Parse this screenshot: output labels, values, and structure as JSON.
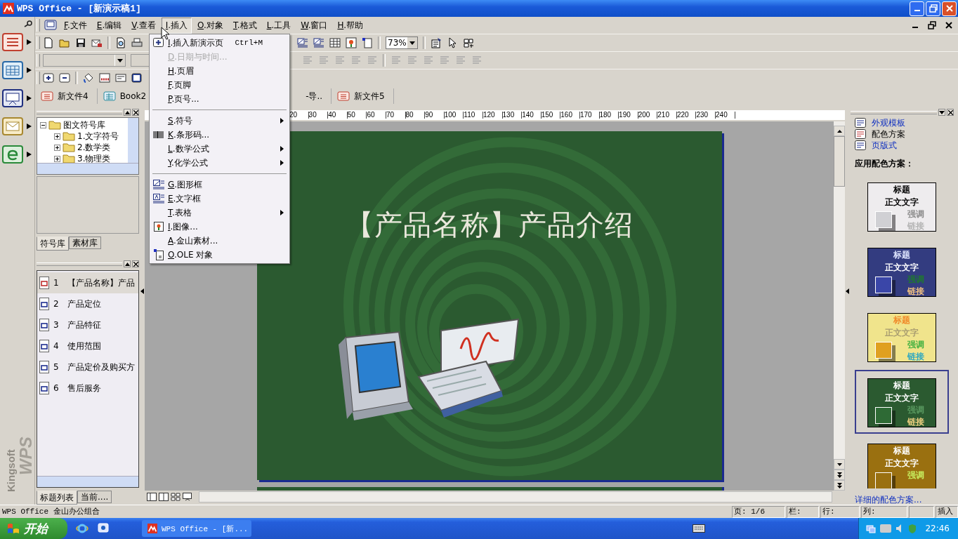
{
  "window": {
    "title": "WPS Office - [新演示稿1]"
  },
  "menubar": [
    {
      "label": "F.文件",
      "selected": false
    },
    {
      "label": "E.编辑",
      "selected": false
    },
    {
      "label": "V.查看",
      "selected": false
    },
    {
      "label": "I.插入",
      "selected": true
    },
    {
      "label": "O.对象",
      "selected": false
    },
    {
      "label": "T.格式",
      "selected": false
    },
    {
      "label": "L.工具",
      "selected": false
    },
    {
      "label": "W.窗口",
      "selected": false
    },
    {
      "label": "H.帮助",
      "selected": false
    }
  ],
  "insert_menu": [
    {
      "kind": "item",
      "label": "I.插入新演示页",
      "shortcut": "Ctrl+M",
      "disabled": false,
      "submenu": false
    },
    {
      "kind": "item",
      "label": "D.日期与时间...",
      "disabled": true,
      "submenu": false
    },
    {
      "kind": "item",
      "label": "H.页眉",
      "disabled": false,
      "submenu": false
    },
    {
      "kind": "item",
      "label": "F.页脚",
      "disabled": false,
      "submenu": false
    },
    {
      "kind": "item",
      "label": "P.页号...",
      "disabled": false,
      "submenu": false
    },
    {
      "kind": "separator"
    },
    {
      "kind": "item",
      "label": "S.符号",
      "disabled": false,
      "submenu": true
    },
    {
      "kind": "item",
      "label": "K.条形码...",
      "disabled": false,
      "submenu": false
    },
    {
      "kind": "item",
      "label": "L.数学公式",
      "disabled": false,
      "submenu": true
    },
    {
      "kind": "item",
      "label": "Y.化学公式",
      "disabled": false,
      "submenu": true
    },
    {
      "kind": "separator"
    },
    {
      "kind": "item",
      "label": "G.图形框",
      "disabled": false,
      "submenu": false
    },
    {
      "kind": "item",
      "label": "E.文字框",
      "disabled": false,
      "submenu": false
    },
    {
      "kind": "item",
      "label": "T.表格",
      "disabled": false,
      "submenu": true
    },
    {
      "kind": "item",
      "label": "I.图像...",
      "disabled": false,
      "submenu": false
    },
    {
      "kind": "item",
      "label": "A.金山素材...",
      "disabled": false,
      "submenu": false
    },
    {
      "kind": "item",
      "label": "O.OLE 对象",
      "disabled": false,
      "submenu": false
    }
  ],
  "toolbar": {
    "zoom": "73%"
  },
  "document_tabs": [
    {
      "label": "新文件4",
      "kind": "presentation"
    },
    {
      "label": "Book2",
      "kind": "spreadsheet"
    },
    {
      "label": "-导..",
      "kind": "other"
    },
    {
      "label": "新文件5",
      "kind": "presentation"
    }
  ],
  "symbol_library": {
    "tree": {
      "label": "图文符号库",
      "expanded": true,
      "children": [
        {
          "label": "1.文字符号",
          "expanded": false
        },
        {
          "label": "2.数学类",
          "expanded": false
        },
        {
          "label": "3.物理类",
          "expanded": false
        }
      ]
    },
    "tabs": [
      {
        "label": "符号库",
        "selected": true
      },
      {
        "label": "素材库",
        "selected": false
      }
    ]
  },
  "slide_outline": {
    "items": [
      {
        "number": "1",
        "title": "【产品名称】产品",
        "selected": true
      },
      {
        "number": "2",
        "title": "产品定位",
        "selected": false
      },
      {
        "number": "3",
        "title": "产品特征",
        "selected": false
      },
      {
        "number": "4",
        "title": "使用范围",
        "selected": false
      },
      {
        "number": "5",
        "title": "产品定价及购买方",
        "selected": false
      },
      {
        "number": "6",
        "title": "售后服务",
        "selected": false
      }
    ],
    "tabs": [
      {
        "label": "标题列表",
        "selected": true
      },
      {
        "label": "当前....",
        "selected": false
      }
    ]
  },
  "ruler": [
    "20",
    "30",
    "40",
    "50",
    "60",
    "70",
    "80",
    "90",
    "100",
    "110",
    "120",
    "130",
    "140",
    "150",
    "160",
    "170",
    "180",
    "190",
    "200",
    "210",
    "220",
    "230",
    "240"
  ],
  "slide": {
    "title": "【产品名称】产品介绍"
  },
  "task_pane": {
    "links": [
      {
        "label": "外观模板",
        "selected": false
      },
      {
        "label": "配色方案",
        "selected": true
      },
      {
        "label": "页版式",
        "selected": false
      }
    ],
    "heading": "应用配色方案：",
    "schemes": [
      {
        "selected": false,
        "color": "#eeecee",
        "title": {
          "text": "标题",
          "color": "#000000"
        },
        "body": {
          "text": "正文文字",
          "color": "#000000"
        },
        "accent": {
          "text": "强调",
          "color": "#8a8a8a"
        },
        "link": {
          "text": "链接",
          "color": "#b4b4b4"
        },
        "box": {
          "color": "#d0d0d4"
        }
      },
      {
        "selected": false,
        "color": "#333c80",
        "title": {
          "text": "标题",
          "color": "#dfe6ff"
        },
        "body": {
          "text": "正文文字",
          "color": "#ffffff"
        },
        "accent": {
          "text": "强调",
          "color": "#1f7a2e"
        },
        "link": {
          "text": "链接",
          "color": "#f0c080"
        },
        "box": {
          "color": "#3a46a8"
        }
      },
      {
        "selected": false,
        "color": "#f0e48c",
        "title": {
          "text": "标题",
          "color": "#f08a2a"
        },
        "body": {
          "text": "正文文字",
          "color": "#a89c70"
        },
        "accent": {
          "text": "强调",
          "color": "#40b040"
        },
        "link": {
          "text": "链接",
          "color": "#30a8c0"
        },
        "box": {
          "color": "#e0a020"
        }
      },
      {
        "selected": true,
        "color": "#2b5a30",
        "title": {
          "text": "标题",
          "color": "#ffffff"
        },
        "body": {
          "text": "正文文字",
          "color": "#ffffff"
        },
        "accent": {
          "text": "强调",
          "color": "#5a9a60"
        },
        "link": {
          "text": "链接",
          "color": "#f0d080"
        },
        "box": {
          "color": "#2e6a35"
        }
      },
      {
        "selected": false,
        "color": "#9a7010",
        "title": {
          "text": "标题",
          "color": "#ffffff"
        },
        "body": {
          "text": "正文文字",
          "color": "#ffffff"
        },
        "accent": {
          "text": "强调",
          "color": "#c8f060"
        },
        "box": {
          "color": "#9a7010"
        }
      }
    ],
    "more_link": "详细的配色方案..."
  },
  "status_bar": {
    "app": "WPS Office 金山办公组合",
    "page": "页: 1/6",
    "column": "栏:",
    "row": "行:",
    "col": "列:",
    "mode": "插入"
  },
  "logo": {
    "line1": "Kingsoft",
    "line2": "WPS"
  },
  "taskbar": {
    "start": "开始",
    "tasks": [
      "WPS Office - [新..."
    ],
    "clock": "22:46"
  }
}
